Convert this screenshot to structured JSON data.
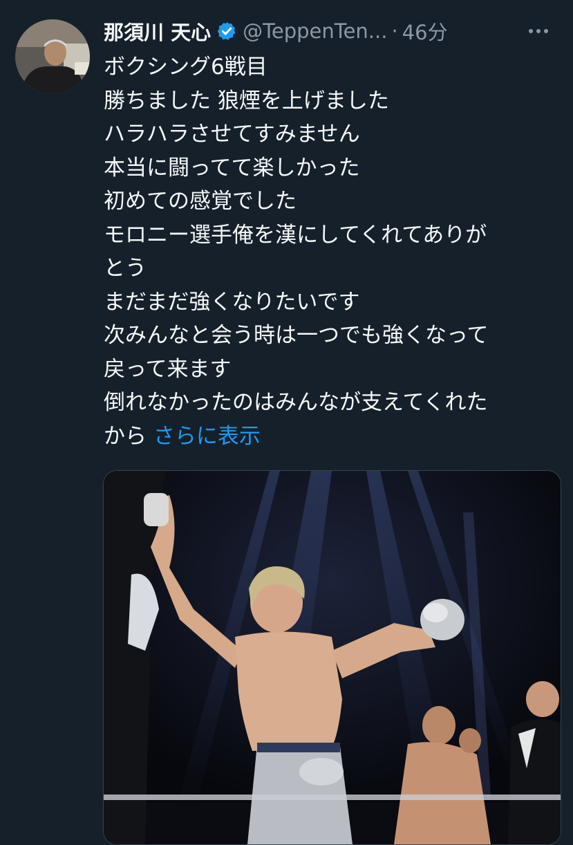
{
  "tweet": {
    "display_name": "那須川 天心",
    "handle": "@TeppenTen...",
    "separator": "·",
    "time": "46分",
    "text_lines": [
      "ボクシング6戦目",
      "勝ちました 狼煙を上げました",
      "ハラハラさせてすみません",
      "本当に闘ってて楽しかった",
      "初めての感覚でした",
      "モロニー選手俺を漢にしてくれてありが",
      "とう",
      "まだまだ強くなりたいです",
      "次みんなと会う時は一つでも強くなって",
      "戻って来ます",
      "倒れなかったのはみんなが支えてくれた",
      "から"
    ],
    "show_more": "さらに表示"
  },
  "icons": {
    "verified": "verified-badge-icon",
    "more": "more-options-icon"
  },
  "colors": {
    "background": "#15202b",
    "text": "#f7f9f9",
    "secondary": "#8b98a5",
    "link": "#1d9bf0",
    "verified": "#1d9bf0"
  }
}
